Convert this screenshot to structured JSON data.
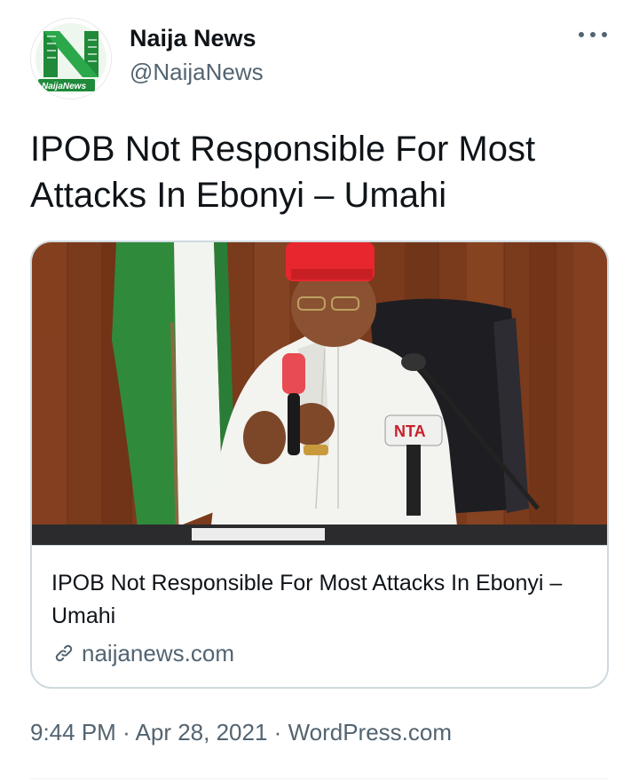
{
  "account": {
    "name": "Naija News",
    "handle": "@NaijaNews",
    "avatar_logo_text": "NaijaNews"
  },
  "tweet": {
    "text": "IPOB Not Responsible For Most Attacks In Ebonyi – Umahi"
  },
  "card": {
    "title": "IPOB Not Responsible For Most Attacks In Ebonyi – Umahi",
    "domain": "naijanews.com",
    "image_microphone_label": "NTA"
  },
  "meta": {
    "time": "9:44 PM",
    "separator": "·",
    "date": "Apr 28, 2021",
    "source": "WordPress.com"
  },
  "icons": {
    "more": "more-horizontal-icon",
    "link": "link-icon"
  },
  "colors": {
    "text": "#0f1419",
    "secondary": "#536471",
    "border": "#cfd9de",
    "logo_green": "#1e8a3a"
  }
}
